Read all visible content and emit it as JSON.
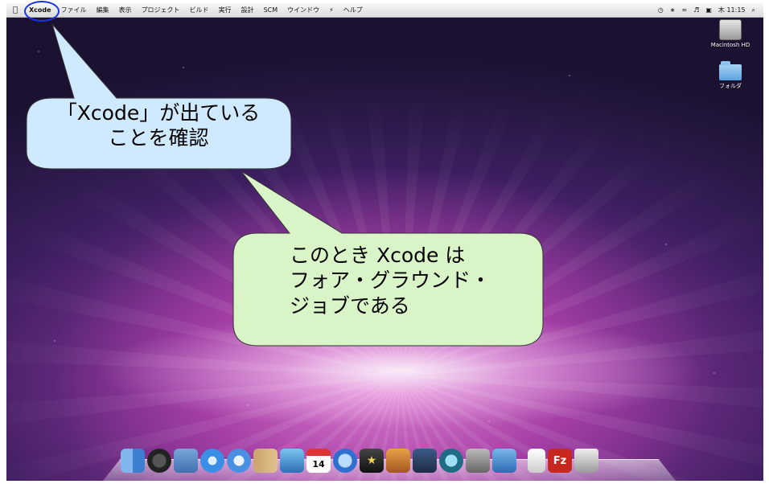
{
  "menubar": {
    "app_name": "Xcode",
    "items": [
      "ファイル",
      "編集",
      "表示",
      "プロジェクト",
      "ビルド",
      "実行",
      "設計",
      "SCM",
      "ウインドウ",
      "ヘルプ"
    ],
    "clock": "木 11:15"
  },
  "desktop": {
    "icons": [
      {
        "label": "Macintosh HD"
      },
      {
        "label": "フォルダ"
      }
    ]
  },
  "callouts": {
    "first": {
      "line1": "「Xcode」が出ている",
      "line2": "ことを確認",
      "fill": "#cfe9ff"
    },
    "second": {
      "line1": "このとき Xcode は",
      "line2": "フォア・グラウンド・",
      "line3": "ジョブである",
      "fill": "#d9f5c8"
    }
  },
  "dock": {
    "items": [
      "finder-icon",
      "dashboard-icon",
      "mail-icon",
      "safari-icon",
      "ichat-icon",
      "address-book-icon",
      "iphoto-icon",
      "ical-icon",
      "itunes-icon",
      "imovie-icon",
      "garageband-icon",
      "spaces-icon",
      "time-machine-icon",
      "system-preferences-icon",
      "xcode-icon",
      "documents-stack-icon",
      "filezilla-icon",
      "trash-icon"
    ],
    "ical_date": "14",
    "filezilla_letter": "Fz"
  },
  "colors": {
    "highlight": "#1a33e0"
  }
}
